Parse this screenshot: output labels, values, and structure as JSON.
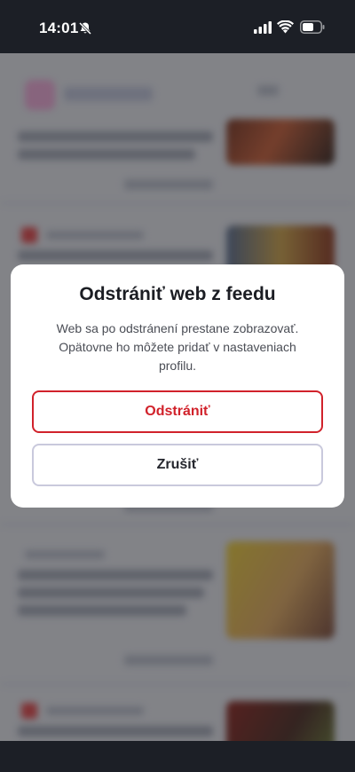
{
  "status_bar": {
    "time": "14:01",
    "icons": [
      "bell-slash-icon",
      "signal-icon",
      "wifi-icon",
      "battery-icon"
    ]
  },
  "dialog": {
    "title": "Odstrániť web z feedu",
    "message": "Web sa po odstránení prestane zobrazovať. Opätovne ho môžete pridať v nastaveniach profilu.",
    "confirm_label": "Odstrániť",
    "cancel_label": "Zrušiť"
  },
  "colors": {
    "danger": "#d1222b",
    "cancel_border": "#c9c9dc",
    "status_bar_bg": "#1c1f26"
  }
}
